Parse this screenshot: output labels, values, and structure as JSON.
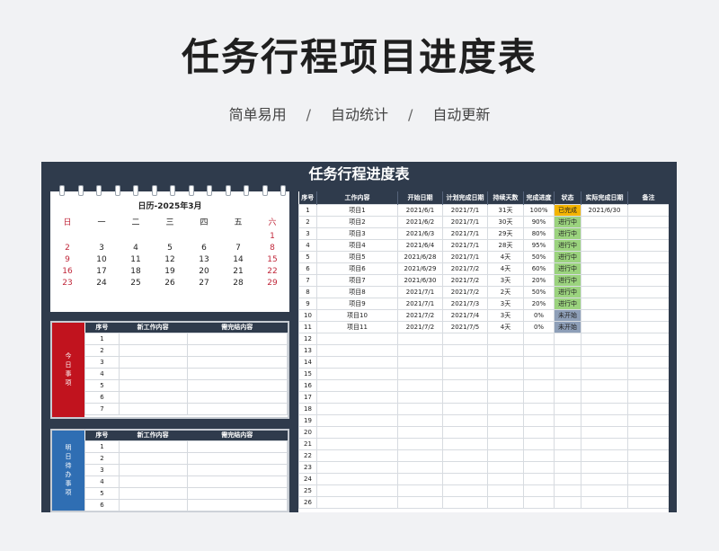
{
  "banner": {
    "title": "任务行程项目进度表",
    "taglines": [
      "简单易用",
      "自动统计",
      "自动更新"
    ],
    "separator": "/"
  },
  "sheet": {
    "title": "任务行程进度表",
    "calendar": {
      "heading": "日历-2025年3月",
      "weekdays": [
        "日",
        "一",
        "二",
        "三",
        "四",
        "五",
        "六"
      ],
      "weeks": [
        [
          "",
          "",
          "",
          "",
          "",
          "",
          "1"
        ],
        [
          "2",
          "3",
          "4",
          "5",
          "6",
          "7",
          "8"
        ],
        [
          "9",
          "10",
          "11",
          "12",
          "13",
          "14",
          "15"
        ],
        [
          "16",
          "17",
          "18",
          "19",
          "20",
          "21",
          "22"
        ],
        [
          "23",
          "24",
          "25",
          "26",
          "27",
          "28",
          "29"
        ]
      ]
    },
    "today": {
      "label": "今日事项",
      "headers": [
        "序号",
        "新工作内容",
        "需完结内容"
      ],
      "rows": [
        "1",
        "2",
        "3",
        "4",
        "5",
        "6",
        "7"
      ]
    },
    "tomorrow": {
      "label": "明日待办事项",
      "headers": [
        "序号",
        "新工作内容",
        "需完结内容"
      ],
      "rows": [
        "1",
        "2",
        "3",
        "4",
        "5",
        "6"
      ]
    },
    "main": {
      "headers": [
        "序号",
        "工作内容",
        "开始日期",
        "计划完成日期",
        "持续天数",
        "完成进度",
        "状态",
        "实际完成日期",
        "备注"
      ],
      "rows": [
        {
          "no": "1",
          "item": "项目1",
          "start": "2021/6/1",
          "plan": "2021/7/1",
          "days": "31天",
          "progress": "100%",
          "status": "已完成",
          "status_kind": "done",
          "actual": "2021/6/30",
          "note": ""
        },
        {
          "no": "2",
          "item": "项目2",
          "start": "2021/6/2",
          "plan": "2021/7/1",
          "days": "30天",
          "progress": "90%",
          "status": "进行中",
          "status_kind": "prog",
          "actual": "",
          "note": ""
        },
        {
          "no": "3",
          "item": "项目3",
          "start": "2021/6/3",
          "plan": "2021/7/1",
          "days": "29天",
          "progress": "80%",
          "status": "进行中",
          "status_kind": "prog",
          "actual": "",
          "note": ""
        },
        {
          "no": "4",
          "item": "项目4",
          "start": "2021/6/4",
          "plan": "2021/7/1",
          "days": "28天",
          "progress": "95%",
          "status": "进行中",
          "status_kind": "prog",
          "actual": "",
          "note": ""
        },
        {
          "no": "5",
          "item": "项目5",
          "start": "2021/6/28",
          "plan": "2021/7/1",
          "days": "4天",
          "progress": "50%",
          "status": "进行中",
          "status_kind": "prog",
          "actual": "",
          "note": ""
        },
        {
          "no": "6",
          "item": "项目6",
          "start": "2021/6/29",
          "plan": "2021/7/2",
          "days": "4天",
          "progress": "60%",
          "status": "进行中",
          "status_kind": "prog",
          "actual": "",
          "note": ""
        },
        {
          "no": "7",
          "item": "项目7",
          "start": "2021/6/30",
          "plan": "2021/7/2",
          "days": "3天",
          "progress": "20%",
          "status": "进行中",
          "status_kind": "prog",
          "actual": "",
          "note": ""
        },
        {
          "no": "8",
          "item": "项目8",
          "start": "2021/7/1",
          "plan": "2021/7/2",
          "days": "2天",
          "progress": "50%",
          "status": "进行中",
          "status_kind": "prog",
          "actual": "",
          "note": ""
        },
        {
          "no": "9",
          "item": "项目9",
          "start": "2021/7/1",
          "plan": "2021/7/3",
          "days": "3天",
          "progress": "20%",
          "status": "进行中",
          "status_kind": "prog",
          "actual": "",
          "note": ""
        },
        {
          "no": "10",
          "item": "项目10",
          "start": "2021/7/2",
          "plan": "2021/7/4",
          "days": "3天",
          "progress": "0%",
          "status": "未开始",
          "status_kind": "not",
          "actual": "",
          "note": ""
        },
        {
          "no": "11",
          "item": "项目11",
          "start": "2021/7/2",
          "plan": "2021/7/5",
          "days": "4天",
          "progress": "0%",
          "status": "未开始",
          "status_kind": "not",
          "actual": "",
          "note": ""
        }
      ],
      "empty_rows": [
        "12",
        "13",
        "14",
        "15",
        "16",
        "17",
        "18",
        "19",
        "20",
        "21",
        "22",
        "23",
        "24",
        "25",
        "26"
      ]
    }
  }
}
